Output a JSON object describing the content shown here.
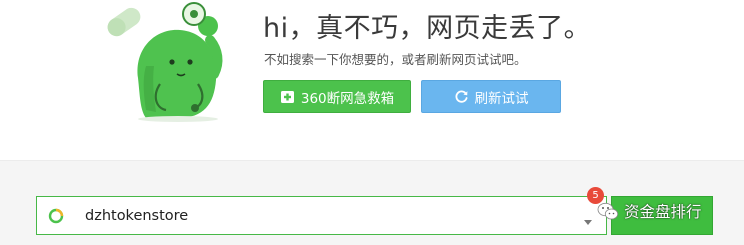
{
  "error": {
    "headline": "hi，真不巧，网页走丢了。",
    "subline": "不如搜索一下你想要的，或者刷新网页试试吧。"
  },
  "actions": {
    "rescue_label": "360断网急救箱",
    "refresh_label": "刷新试试"
  },
  "search": {
    "value": "dzhtokenstore",
    "badge_count": "5"
  },
  "watermark": {
    "text": "资金盘排行"
  },
  "colors": {
    "green": "#4cc24c",
    "blue": "#6ab6ef",
    "badge_red": "#e84a3a"
  }
}
